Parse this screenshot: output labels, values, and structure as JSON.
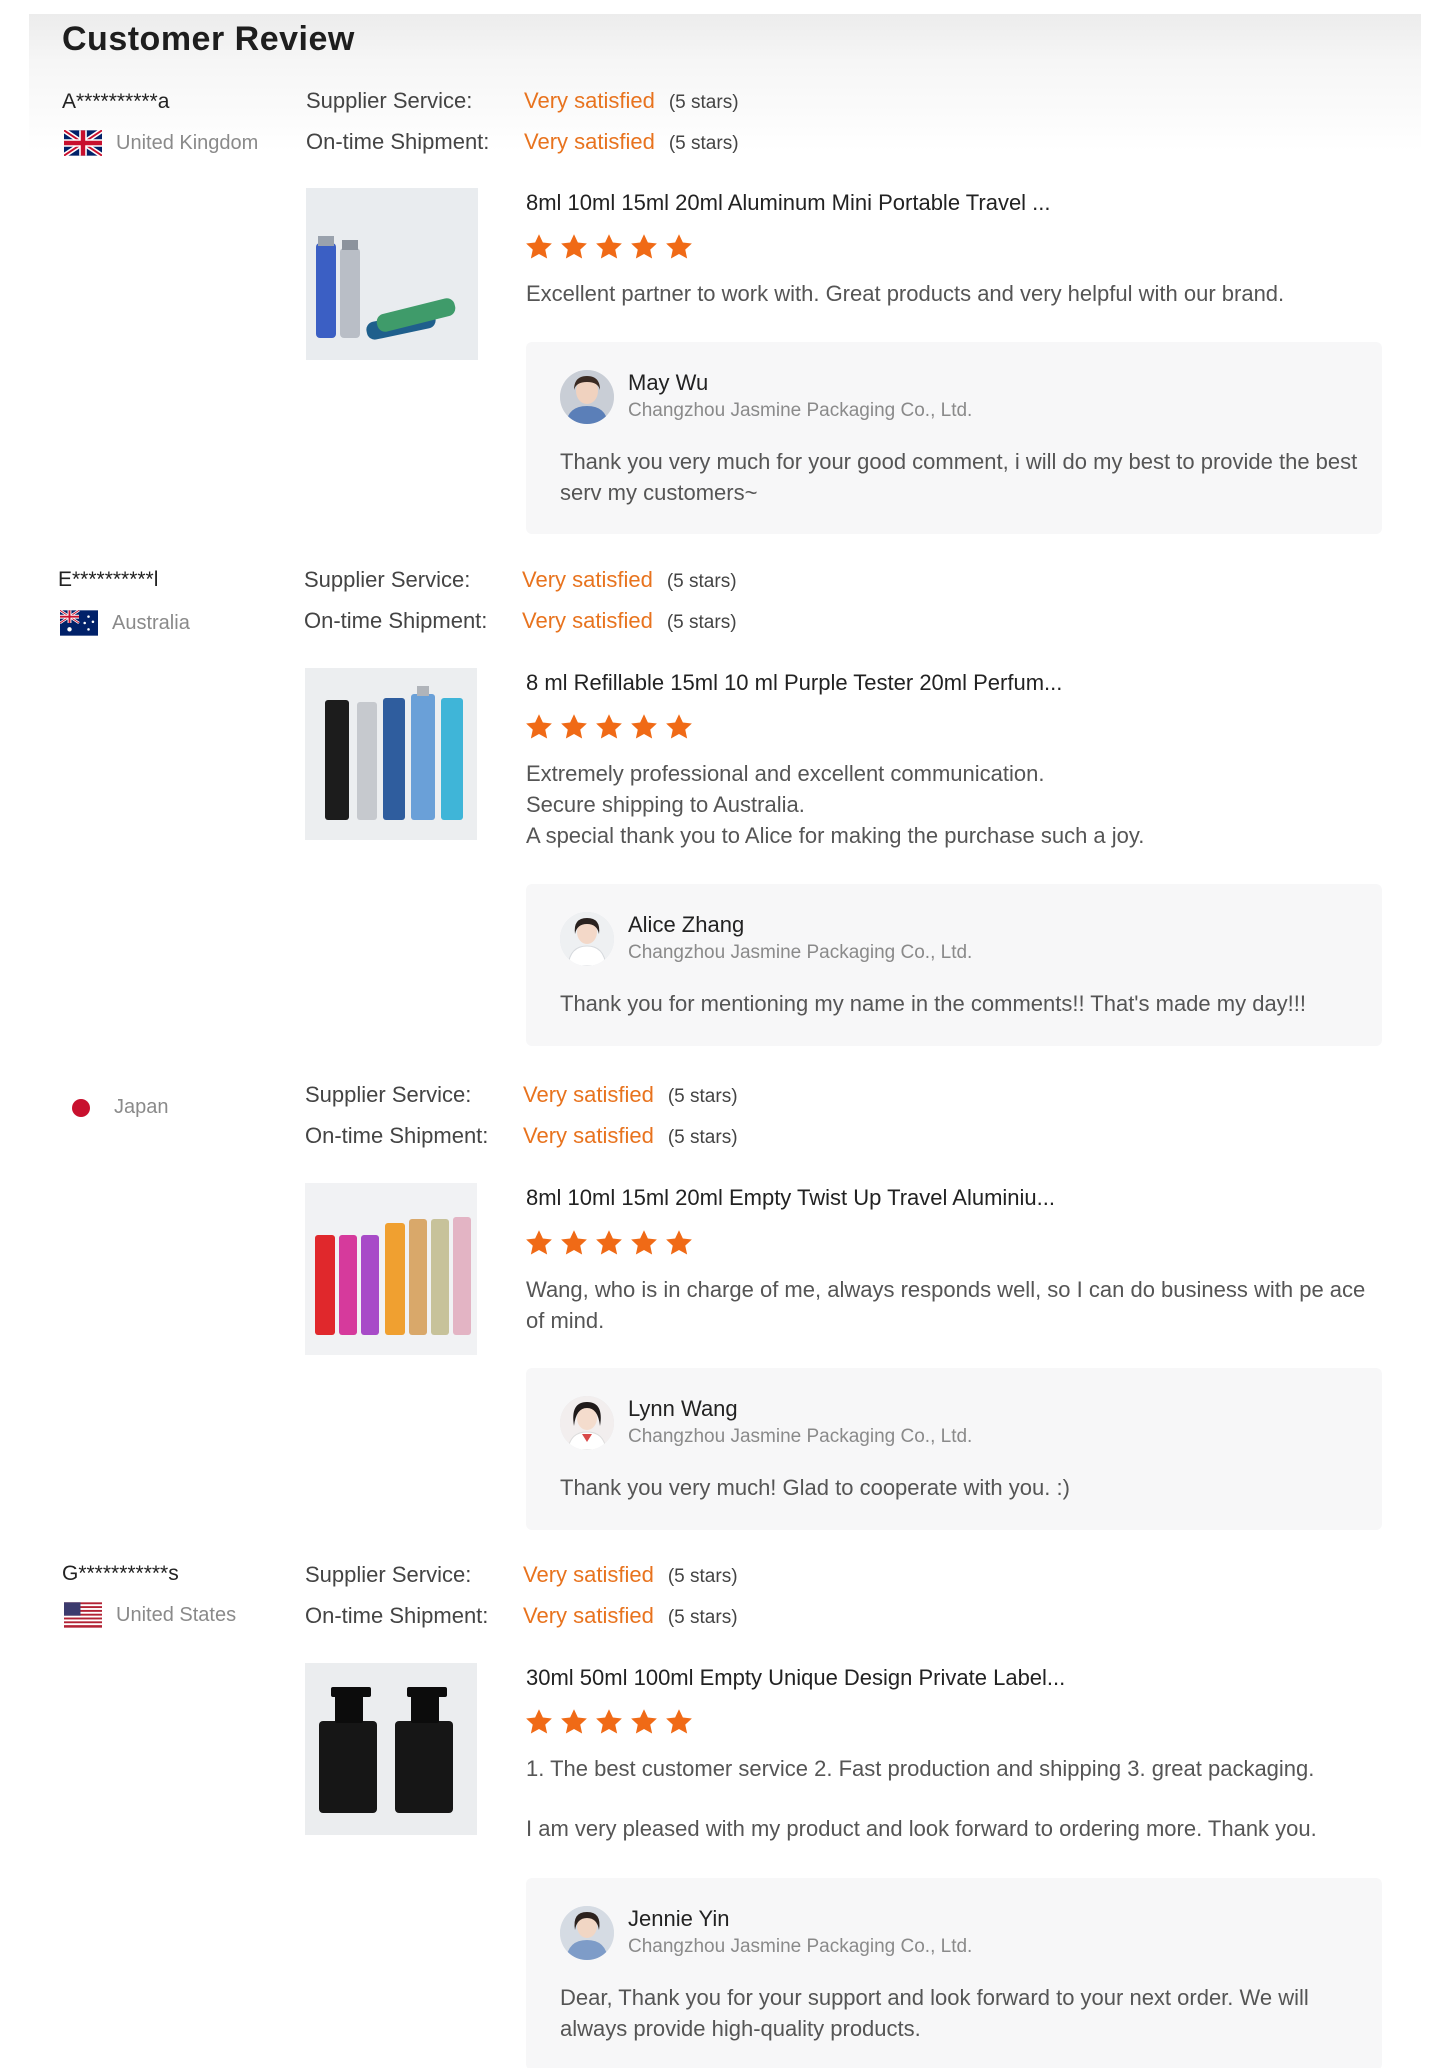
{
  "page": {
    "title": "Customer Review"
  },
  "labels": {
    "supplier_service": "Supplier Service:",
    "ontime_shipment": "On-time Shipment:"
  },
  "colors": {
    "accent": "#e8731e",
    "star": "#f06a16",
    "reply_bg": "#f7f7f8"
  },
  "reviews": [
    {
      "buyer": "A**********a",
      "country": "United Kingdom",
      "flag_icon": "uk-flag-icon",
      "supplier_service": {
        "value": "Very satisfied",
        "stars_text": "(5 stars)"
      },
      "ontime_shipment": {
        "value": "Very satisfied",
        "stars_text": "(5 stars)"
      },
      "product_title": "8ml 10ml 15ml 20ml Aluminum Mini Portable Travel ...",
      "rating": 5,
      "comment": "Excellent partner to work with. Great products and very helpful with our brand.",
      "reply": {
        "name": "May Wu",
        "company": "Changzhou Jasmine Packaging Co., Ltd.",
        "text": "Thank you very much for your good comment, i will do my best to provide the best serv my customers~"
      }
    },
    {
      "buyer": "E**********l",
      "country": "Australia",
      "flag_icon": "australia-flag-icon",
      "supplier_service": {
        "value": "Very satisfied",
        "stars_text": "(5 stars)"
      },
      "ontime_shipment": {
        "value": "Very satisfied",
        "stars_text": "(5 stars)"
      },
      "product_title": "8 ml Refillable 15ml 10 ml Purple Tester 20ml Perfum...",
      "rating": 5,
      "comment_lines": [
        "Extremely professional and excellent communication.",
        "Secure shipping to Australia.",
        "A special thank you to Alice for making the purchase such a joy."
      ],
      "reply": {
        "name": "Alice Zhang",
        "company": "Changzhou Jasmine Packaging Co., Ltd.",
        "text": "Thank you for mentioning my name in the comments!! That's made my day!!!"
      }
    },
    {
      "buyer": "",
      "country": "Japan",
      "flag_icon": "japan-flag-icon",
      "supplier_service": {
        "value": "Very satisfied",
        "stars_text": "(5 stars)"
      },
      "ontime_shipment": {
        "value": "Very satisfied",
        "stars_text": "(5 stars)"
      },
      "product_title": "8ml 10ml 15ml 20ml Empty Twist Up Travel Aluminiu...",
      "rating": 5,
      "comment": "Wang, who is in charge of me, always responds well, so I can do business with pe ace of mind.",
      "reply": {
        "name": "Lynn Wang",
        "company": "Changzhou Jasmine Packaging Co., Ltd.",
        "text": "Thank you very much! Glad to cooperate with you. :)"
      }
    },
    {
      "buyer": "G***********s",
      "country": "United States",
      "flag_icon": "usa-flag-icon",
      "supplier_service": {
        "value": "Very satisfied",
        "stars_text": "(5 stars)"
      },
      "ontime_shipment": {
        "value": "Very satisfied",
        "stars_text": "(5 stars)"
      },
      "product_title": "30ml 50ml 100ml Empty Unique Design Private Label...",
      "rating": 5,
      "comment_lines": [
        "1. The best customer service 2. Fast production and shipping 3. great packaging.",
        "I am very pleased with my product and look forward to ordering more. Thank you."
      ],
      "reply": {
        "name": "Jennie Yin",
        "company": "Changzhou Jasmine Packaging Co., Ltd.",
        "text": "Dear, Thank you for your support and look forward to your next order. We will always provide high-quality products."
      }
    }
  ]
}
